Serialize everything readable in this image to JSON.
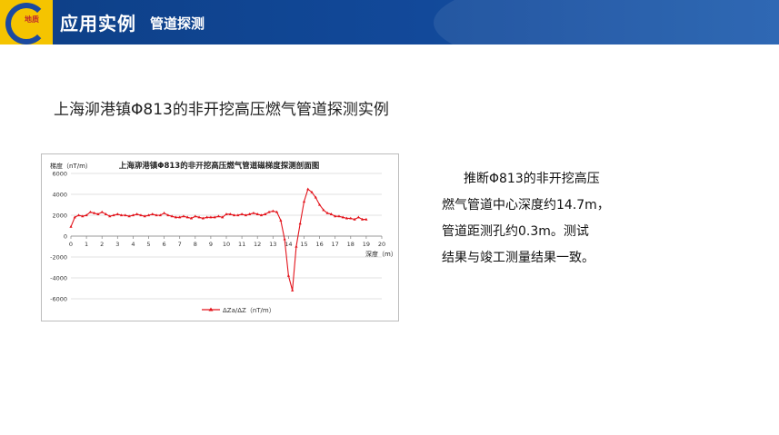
{
  "header": {
    "logo_text": "地质",
    "title": "应用实例",
    "subtitle": "管道探测"
  },
  "page_title": "上海泖港镇Φ813的非开挖高压燃气管道探测实例",
  "description": {
    "lines": [
      "推断Φ813的非开挖高压",
      "燃气管道中心深度约14.7m，",
      "管道距测孔约0.3m。测试",
      "结果与竣工测量结果一致。"
    ]
  },
  "colors": {
    "header_bg": "#12499a",
    "logo_bg": "#f5c400",
    "series": "#e3141c"
  },
  "chart_data": {
    "type": "line",
    "title": "上海泖港镇Φ813的非开挖高压燃气管道磁梯度探测剖面图",
    "ylabel": "梯度（nT/m）",
    "xlabel": "深度（m）",
    "xlim": [
      0,
      20
    ],
    "ylim": [
      -6000,
      6000
    ],
    "x_ticks": [
      0,
      1,
      2,
      3,
      4,
      5,
      6,
      7,
      8,
      9,
      10,
      11,
      12,
      13,
      14,
      15,
      16,
      17,
      18,
      19,
      20
    ],
    "y_ticks": [
      -6000,
      -4000,
      -2000,
      0,
      2000,
      4000,
      6000
    ],
    "grid": "horizontal",
    "legend_position": "bottom",
    "series": [
      {
        "name": "ΔZa/ΔZ（nT/m）",
        "x": [
          0,
          0.25,
          0.5,
          0.75,
          1,
          1.25,
          1.5,
          1.75,
          2,
          2.25,
          2.5,
          2.75,
          3,
          3.25,
          3.5,
          3.75,
          4,
          4.25,
          4.5,
          4.75,
          5,
          5.25,
          5.5,
          5.75,
          6,
          6.25,
          6.5,
          6.75,
          7,
          7.25,
          7.5,
          7.75,
          8,
          8.25,
          8.5,
          8.75,
          9,
          9.25,
          9.5,
          9.75,
          10,
          10.25,
          10.5,
          10.75,
          11,
          11.25,
          11.5,
          11.75,
          12,
          12.25,
          12.5,
          12.75,
          13,
          13.25,
          13.5,
          13.75,
          14,
          14.25,
          14.5,
          14.75,
          15,
          15.25,
          15.5,
          15.75,
          16,
          16.25,
          16.5,
          16.75,
          17,
          17.25,
          17.5,
          17.75,
          18,
          18.25,
          18.5,
          18.75,
          19
        ],
        "y": [
          900,
          1800,
          2000,
          1900,
          2000,
          2300,
          2200,
          2100,
          2300,
          2100,
          1900,
          2000,
          2100,
          2000,
          2000,
          1900,
          2000,
          2100,
          2000,
          1900,
          2000,
          2100,
          2000,
          2000,
          2200,
          2000,
          1900,
          1800,
          1800,
          1900,
          1800,
          1700,
          1900,
          1800,
          1700,
          1800,
          1800,
          1800,
          1900,
          1800,
          2100,
          2100,
          2000,
          2000,
          2100,
          2000,
          2100,
          2200,
          2100,
          2000,
          2100,
          2300,
          2400,
          2300,
          1500,
          -300,
          -3800,
          -5200,
          -1000,
          1200,
          3300,
          4500,
          4200,
          3700,
          3000,
          2500,
          2200,
          2100,
          1900,
          1900,
          1800,
          1700,
          1700,
          1600,
          1800,
          1600,
          1600
        ]
      }
    ]
  }
}
